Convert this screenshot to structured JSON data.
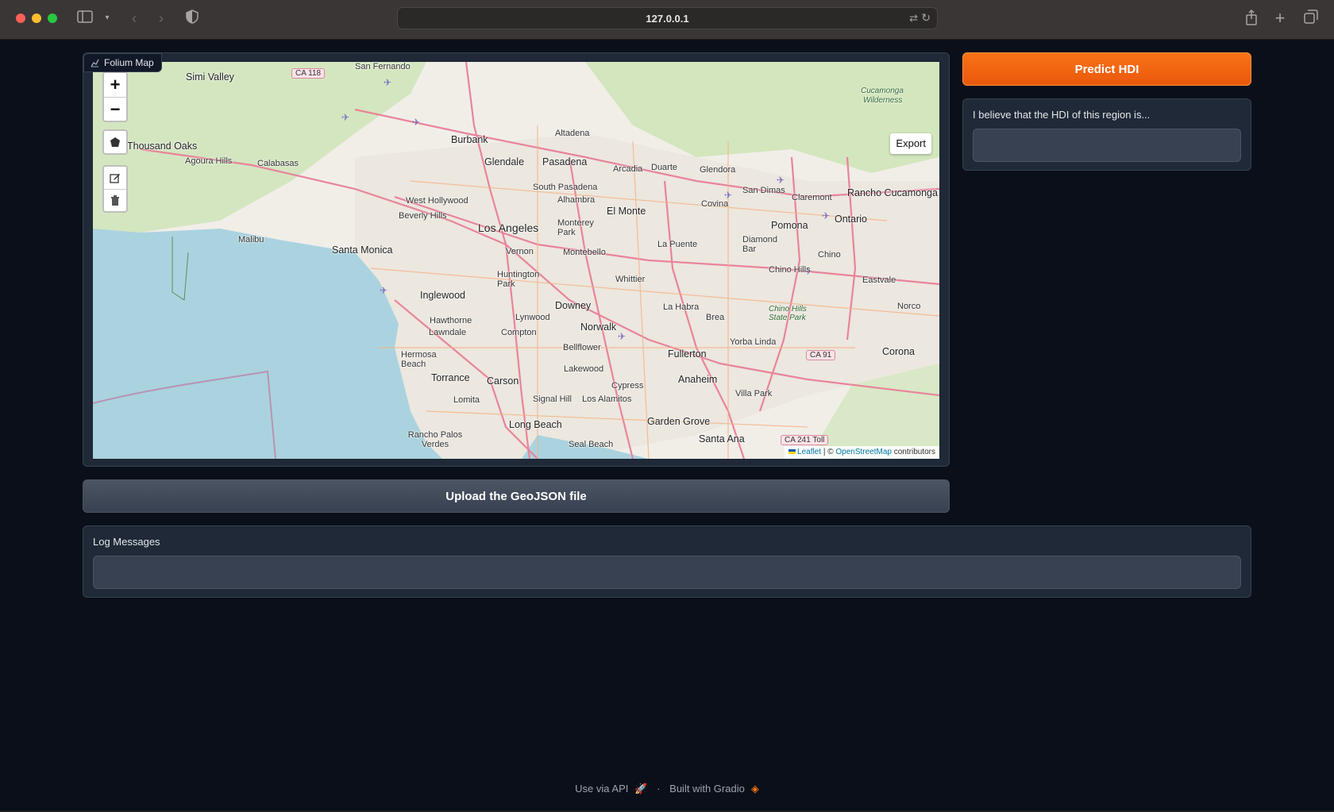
{
  "browser": {
    "url": "127.0.0.1"
  },
  "map": {
    "label": "Folium Map",
    "zoom_in": "+",
    "zoom_out": "−",
    "export_label": "Export",
    "attribution": {
      "leaflet": "Leaflet",
      "separator": " | © ",
      "osm": "OpenStreetMap",
      "suffix": " contributors"
    },
    "places": {
      "simi_valley": "Simi Valley",
      "san_fernando": "San Fernando",
      "ca118": "CA 118",
      "thousand_oaks": "Thousand Oaks",
      "agoura_hills": "Agoura Hills",
      "calabasas": "Calabasas",
      "burbank": "Burbank",
      "glendale": "Glendale",
      "pasadena": "Pasadena",
      "altadena": "Altadena",
      "arcadia": "Arcadia",
      "duarte": "Duarte",
      "glendora": "Glendora",
      "cucamonga": "Cucamonga",
      "wilderness": "Wilderness",
      "west_hollywood": "West Hollywood",
      "beverly_hills": "Beverly Hills",
      "south_pasadena": "South Pasadena",
      "alhambra": "Alhambra",
      "el_monte": "El Monte",
      "covina": "Covina",
      "san_dimas": "San Dimas",
      "claremont": "Claremont",
      "rancho_cucamonga": "Rancho Cucamonga",
      "los_angeles": "Los Angeles",
      "monterey_park": "Monterey Park",
      "pomona": "Pomona",
      "ontario": "Ontario",
      "malibu": "Malibu",
      "santa_monica": "Santa Monica",
      "vernon": "Vernon",
      "montebello": "Montebello",
      "la_puente": "La Puente",
      "diamond_bar": "Diamond Bar",
      "chino": "Chino",
      "huntington_park": "Huntington Park",
      "whittier": "Whittier",
      "chino_hills": "Chino Hills",
      "eastvale": "Eastvale",
      "inglewood": "Inglewood",
      "downey": "Downey",
      "lynwood": "Lynwood",
      "la_habra": "La Habra",
      "brea": "Brea",
      "chino_hills_state_park": "Chino Hills State Park",
      "norco": "Norco",
      "hawthorne": "Hawthorne",
      "lawndale": "Lawndale",
      "compton": "Compton",
      "norwalk": "Norwalk",
      "bellflower": "Bellflower",
      "fullerton": "Fullerton",
      "yorba_linda": "Yorba Linda",
      "ca91": "CA 91",
      "corona": "Corona",
      "hermosa_beach": "Hermosa Beach",
      "torrance": "Torrance",
      "carson": "Carson",
      "lakewood": "Lakewood",
      "anaheim": "Anaheim",
      "cypress": "Cypress",
      "villa_park": "Villa Park",
      "lomita": "Lomita",
      "signal_hill": "Signal Hill",
      "los_alamitos": "Los Alamitos",
      "long_beach": "Long Beach",
      "garden_grove": "Garden Grove",
      "rancho_palos_verdes": "Rancho Palos Verdes",
      "seal_beach": "Seal Beach",
      "santa_ana": "Santa Ana",
      "ca241": "CA 241 Toll"
    }
  },
  "predict": {
    "button_label": "Predict HDI"
  },
  "hdi_output": {
    "label": "I believe that the HDI of this region is...",
    "value": ""
  },
  "upload": {
    "button_label": "Upload the GeoJSON file"
  },
  "log": {
    "label": "Log Messages",
    "value": ""
  },
  "footer": {
    "api_label": "Use via API",
    "separator": "·",
    "built_label": "Built with Gradio"
  }
}
